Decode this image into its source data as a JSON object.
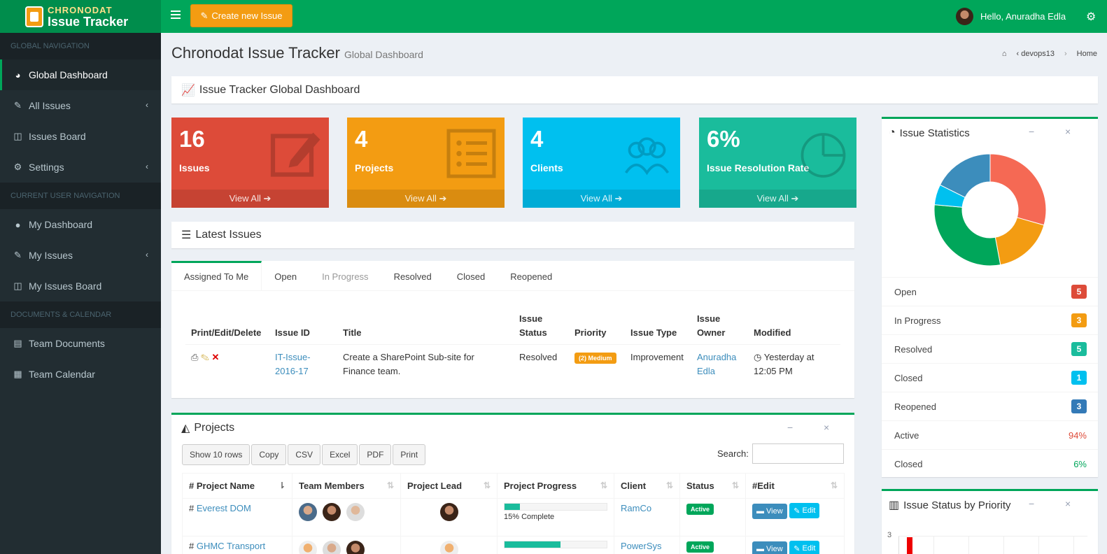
{
  "app": {
    "logo_small": "CHRONODAT",
    "logo_large": "Issue Tracker"
  },
  "topbar": {
    "create_label": "Create new Issue",
    "user_greeting": "Hello, Anuradha Edla"
  },
  "sidebar": {
    "sections": [
      {
        "header": "GLOBAL NAVIGATION",
        "items": [
          {
            "label": "Global Dashboard",
            "icon": "dashboard-icon",
            "active": true
          },
          {
            "label": "All Issues",
            "icon": "edit-icon",
            "chevron": true
          },
          {
            "label": "Issues Board",
            "icon": "columns-icon"
          },
          {
            "label": "Settings",
            "icon": "gears-icon",
            "chevron": true
          }
        ]
      },
      {
        "header": "CURRENT USER NAVIGATION",
        "items": [
          {
            "label": "My Dashboard",
            "icon": "user-icon"
          },
          {
            "label": "My Issues",
            "icon": "edit-icon",
            "chevron": true
          },
          {
            "label": "My Issues Board",
            "icon": "columns-icon"
          }
        ]
      },
      {
        "header": "DOCUMENTS & CALENDAR",
        "items": [
          {
            "label": "Team Documents",
            "icon": "book-icon"
          },
          {
            "label": "Team Calendar",
            "icon": "calendar-icon"
          }
        ]
      }
    ]
  },
  "page": {
    "title": "Chronodat Issue Tracker",
    "subtitle": "Global Dashboard",
    "breadcrumb": [
      "devops13",
      "Home"
    ]
  },
  "dashboard_header": "Issue Tracker Global Dashboard",
  "small_boxes": [
    {
      "value": "16",
      "label": "Issues",
      "footer": "View All",
      "color": "#dd4b39",
      "icon": "edit-icon"
    },
    {
      "value": "4",
      "label": "Projects",
      "footer": "View All",
      "color": "#f39c12",
      "icon": "list-icon"
    },
    {
      "value": "4",
      "label": "Clients",
      "footer": "View All",
      "color": "#00c0ef",
      "icon": "users-icon"
    },
    {
      "value": "6%",
      "label": "Issue Resolution Rate",
      "footer": "View All",
      "color": "#1abc9c",
      "icon": "pie-chart-icon"
    }
  ],
  "latest_issues": {
    "title": "Latest Issues",
    "tabs": [
      "Assigned To Me",
      "Open",
      "In Progress",
      "Resolved",
      "Closed",
      "Reopened"
    ],
    "columns": [
      "Print/Edit/Delete",
      "Issue ID",
      "Title",
      "Issue Status",
      "Priority",
      "Issue Type",
      "Issue Owner",
      "Modified"
    ],
    "rows": [
      {
        "id": "IT-Issue-2016-17",
        "title": "Create a SharePoint Sub-site for Finance team.",
        "status": "Resolved",
        "priority": "(2) Medium",
        "type": "Improvement",
        "owner": "Anuradha Edla",
        "modified": "Yesterday at 12:05 PM"
      }
    ]
  },
  "projects": {
    "title": "Projects",
    "buttons": [
      "Show 10 rows",
      "Copy",
      "CSV",
      "Excel",
      "PDF",
      "Print"
    ],
    "search_label": "Search:",
    "columns": [
      "# Project Name",
      "Team Members",
      "Project Lead",
      "Project Progress",
      "Client",
      "Status",
      "#Edit"
    ],
    "rows": [
      {
        "name": "Everest DOM",
        "progress": 0.15,
        "progress_label": "15% Complete",
        "client": "RamCo",
        "status": "Active",
        "view": "View",
        "edit": "Edit"
      },
      {
        "name": "GHMC Transport",
        "progress": 0.55,
        "progress_label": "",
        "client": "PowerSys",
        "status": "Active",
        "view": "View",
        "edit": "Edit"
      }
    ]
  },
  "issue_stats": {
    "title": "Issue Statistics",
    "rows": [
      {
        "label": "Open",
        "value": "5",
        "color": "#dd4b39"
      },
      {
        "label": "In Progress",
        "value": "3",
        "color": "#f39c12"
      },
      {
        "label": "Resolved",
        "value": "5",
        "color": "#1abc9c"
      },
      {
        "label": "Closed",
        "value": "1",
        "color": "#00c0ef"
      },
      {
        "label": "Reopened",
        "value": "3",
        "color": "#337ab7"
      }
    ],
    "percent_rows": [
      {
        "label": "Active",
        "value": "94%",
        "color": "#dd4b39"
      },
      {
        "label": "Closed",
        "value": "6%",
        "color": "#00a65a"
      }
    ]
  },
  "chart_data": {
    "type": "pie",
    "categories": [
      "Open",
      "In Progress",
      "Resolved",
      "Closed",
      "Reopened"
    ],
    "values": [
      5,
      3,
      5,
      1,
      3
    ],
    "colors": [
      "#f56954",
      "#f39c12",
      "#00a65a",
      "#00c0ef",
      "#3c8dbc"
    ]
  },
  "priority_box": {
    "title": "Issue Status by Priority",
    "axis_tick": "3"
  }
}
